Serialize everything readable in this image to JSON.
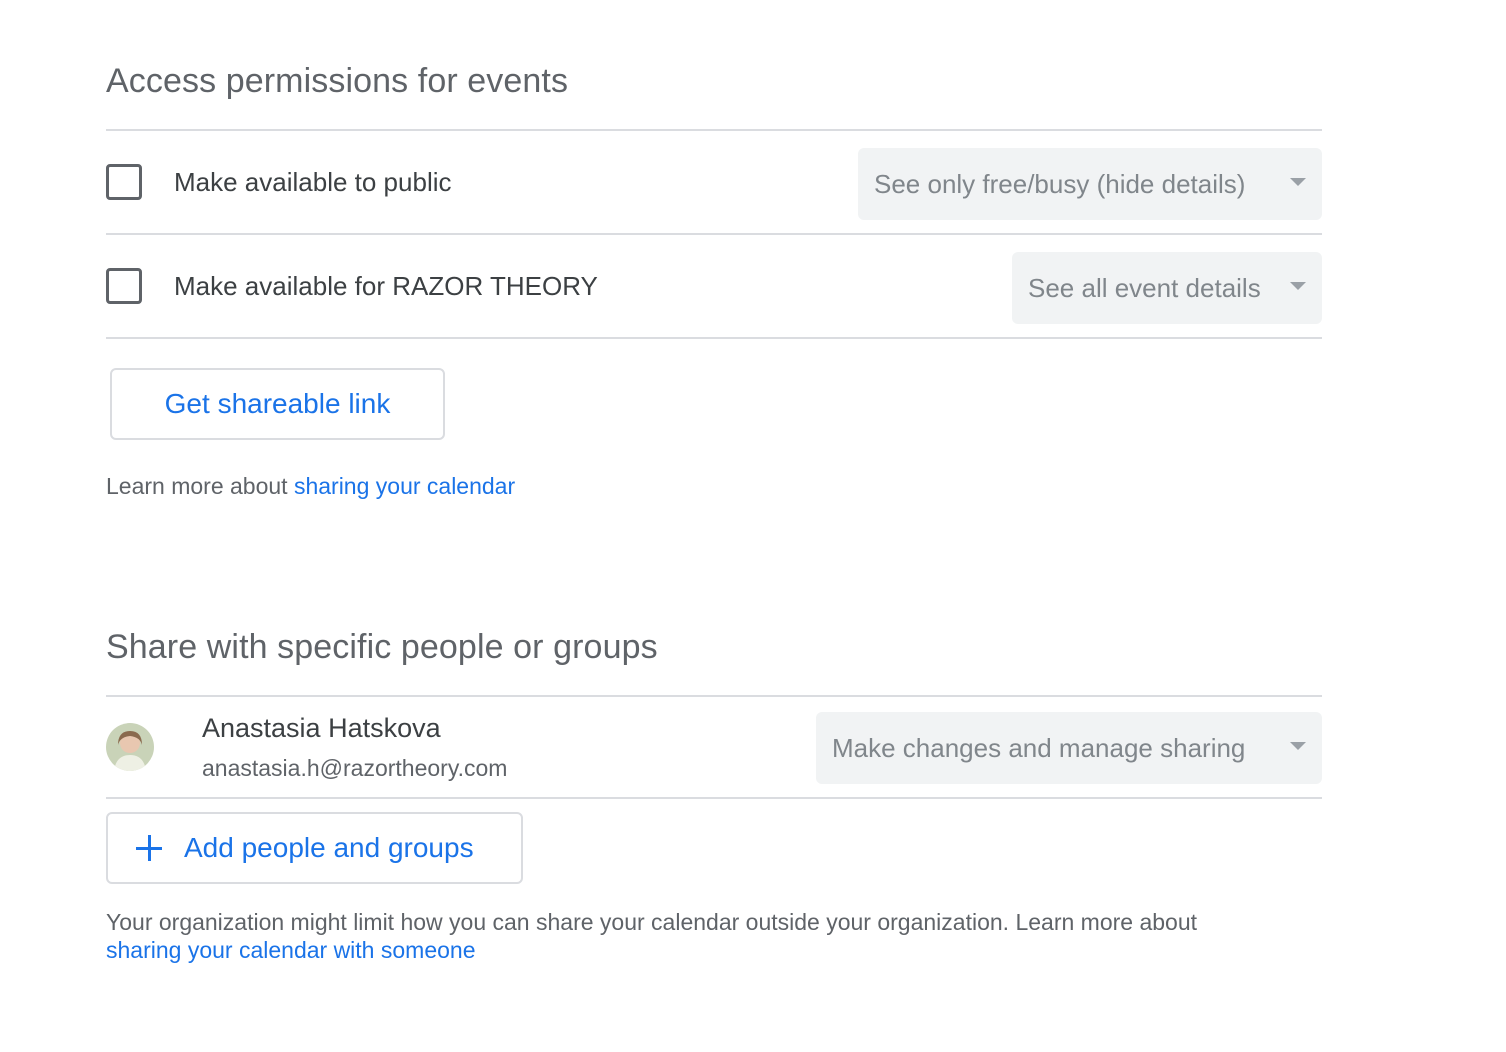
{
  "access": {
    "title": "Access permissions for events",
    "rows": [
      {
        "label": "Make available to public",
        "checked": false,
        "select_value": "See only free/busy (hide details)"
      },
      {
        "label": "Make available for RAZOR THEORY",
        "checked": false,
        "select_value": "See all event details"
      }
    ],
    "shareable_link_label": "Get shareable link",
    "help_prefix": "Learn more about ",
    "help_link": "sharing your calendar"
  },
  "share": {
    "title": "Share with specific people or groups",
    "person": {
      "name": "Anastasia Hatskova",
      "email": "anastasia.h@razortheory.com",
      "permission": "Make changes and manage sharing"
    },
    "add_label": "Add people and groups",
    "help_prefix": "Your organization might limit how you can share your calendar outside your organization. Learn more about",
    "help_link": "sharing your calendar with someone"
  },
  "colors": {
    "accent": "#1a73e8",
    "divider": "#dadce0",
    "select_bg": "#f1f3f4"
  },
  "icons": {
    "add": "plus-icon",
    "dropdown": "caret-down-icon"
  }
}
